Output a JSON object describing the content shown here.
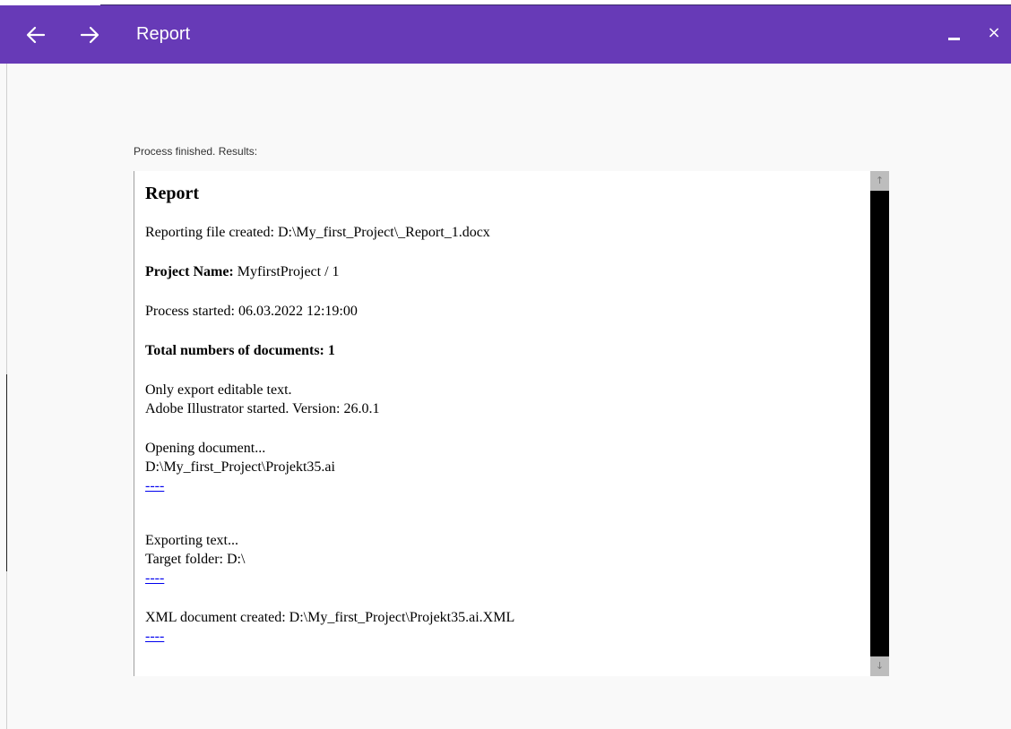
{
  "window": {
    "title": "Report",
    "accent_color": "#673ab7",
    "back_icon": "arrow-left-icon",
    "forward_icon": "arrow-right-icon",
    "minimize_icon": "minimize-icon",
    "close_label": "×"
  },
  "status_text": "Process finished. Results:",
  "report": {
    "heading": "Report",
    "reporting_file": "Reporting file created: D:\\My_first_Project\\_Report_1.docx",
    "project_label": "Project Name:",
    "project_value": " MyfirstProject / 1",
    "process_started": "Process started: 06.03.2022 12:19:00",
    "total_documents": "Total numbers of documents: 1",
    "export_mode": "Only export editable text.",
    "illustrator_started": "Adobe Illustrator started. Version: 26.0.1",
    "opening": "Opening document...",
    "opening_path": "D:\\My_first_Project\\Projekt35.ai",
    "link1": "----",
    "exporting": "Exporting text...",
    "target_folder": "Target folder: D:\\",
    "link2": "----",
    "xml_created": "XML document created: D:\\My_first_Project\\Projekt35.ai.XML",
    "link3": "----"
  },
  "scrollbar": {
    "up_arrow": "↑",
    "down_arrow": "↓"
  }
}
